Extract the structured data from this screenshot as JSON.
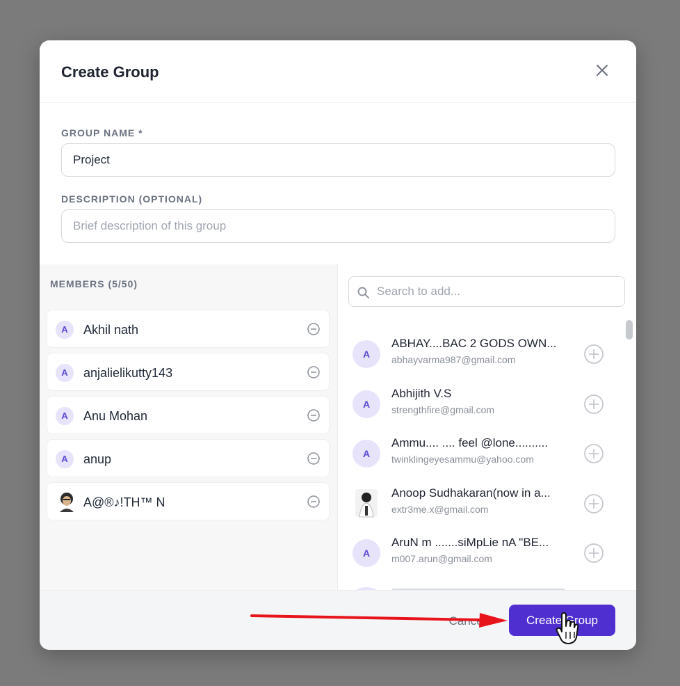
{
  "dialog": {
    "title": "Create Group",
    "close_icon": "close-icon"
  },
  "form": {
    "group_name_label": "GROUP NAME *",
    "group_name_value": "Project",
    "description_label": "DESCRIPTION (OPTIONAL)",
    "description_placeholder": "Brief description of this group"
  },
  "members": {
    "title": "MEMBERS (5/50)",
    "items": [
      {
        "initial": "A",
        "name": "Akhil nath",
        "avatar": "letter"
      },
      {
        "initial": "A",
        "name": "anjalielikutty143",
        "avatar": "letter"
      },
      {
        "initial": "A",
        "name": "Anu Mohan",
        "avatar": "letter"
      },
      {
        "initial": "A",
        "name": "anup",
        "avatar": "letter"
      },
      {
        "initial": "",
        "name": "A@®♪!TH™ N",
        "avatar": "photo"
      }
    ],
    "remove_icon": "minus-circle-icon"
  },
  "search": {
    "placeholder": "Search to add..."
  },
  "results": {
    "items": [
      {
        "initial": "A",
        "name": "ABHAY....BAC 2 GODS OWN...",
        "email": "abhayvarma987@gmail.com",
        "avatar": "letter"
      },
      {
        "initial": "A",
        "name": "Abhijith V.S",
        "email": "strengthfire@gmail.com",
        "avatar": "letter"
      },
      {
        "initial": "A",
        "name": "Ammu.... .... feel @lone..........",
        "email": "twinklingeyesammu@yahoo.com",
        "avatar": "letter"
      },
      {
        "initial": "",
        "name": "Anoop Sudhakaran(now in a...",
        "email": "extr3me.x@gmail.com",
        "avatar": "photo"
      },
      {
        "initial": "A",
        "name": "AruN m .......siMpLie nA \"BE...",
        "email": "m007.arun@gmail.com",
        "avatar": "letter"
      }
    ],
    "add_icon": "plus-circle-icon"
  },
  "footer": {
    "cancel_label": "Cancel",
    "create_label": "Create Group"
  },
  "colors": {
    "accent": "#4f2fd0",
    "avatar_bg": "#e6e3fb",
    "annotation_arrow": "#e8141b"
  }
}
